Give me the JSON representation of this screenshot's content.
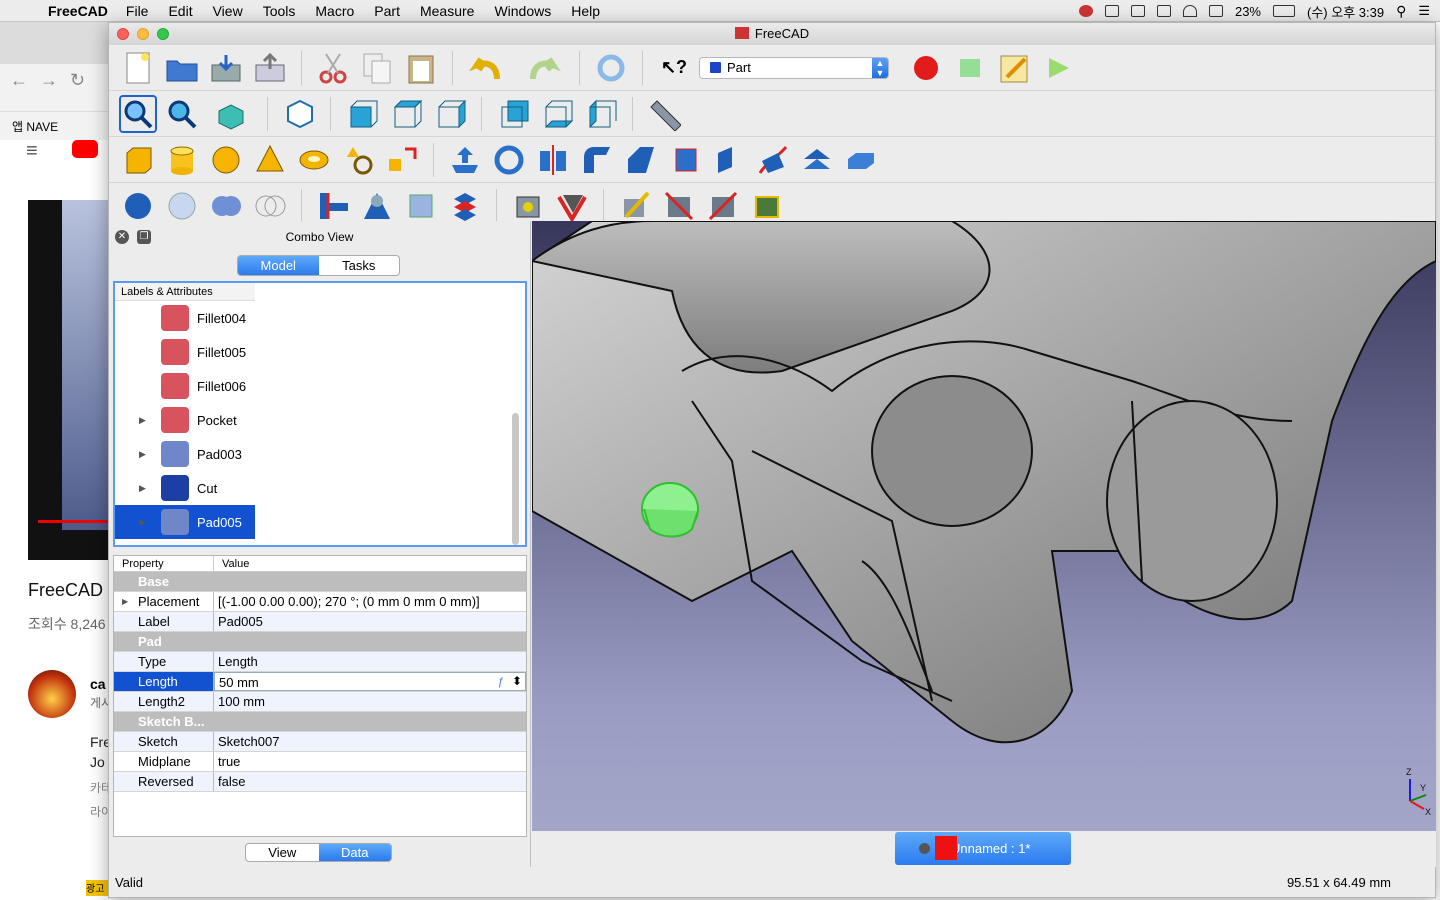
{
  "macos_menubar": {
    "app_name": "FreeCAD",
    "menus": [
      "File",
      "Edit",
      "View",
      "Tools",
      "Macro",
      "Part",
      "Measure",
      "Windows",
      "Help"
    ],
    "battery": "23%",
    "clock": "(수) 오후 3:39"
  },
  "browser_background": {
    "bookmark_apps": "앱",
    "bookmark_naver": "NAVE",
    "video_title": "FreeCAD U",
    "views": "조회수 8,246",
    "channel": "ca",
    "channel_sub": "게시",
    "desc_lines": [
      "Fre",
      "Jo",
      "카테",
      "라이"
    ],
    "ad_label": "광고"
  },
  "window": {
    "title": "FreeCAD",
    "workbench": "Part"
  },
  "combo_view": {
    "title": "Combo View",
    "tabs": [
      "Model",
      "Tasks"
    ],
    "active_tab": "Model",
    "tree_header": "Labels & Attributes",
    "tree_items": [
      {
        "label": "Fillet004",
        "expandable": false,
        "color": "#d9535e",
        "selected": false
      },
      {
        "label": "Fillet005",
        "expandable": false,
        "color": "#d9535e",
        "selected": false
      },
      {
        "label": "Fillet006",
        "expandable": false,
        "color": "#d9535e",
        "selected": false
      },
      {
        "label": "Pocket",
        "expandable": true,
        "color": "#d9535e",
        "selected": false
      },
      {
        "label": "Pad003",
        "expandable": true,
        "color": "#6f86c9",
        "selected": false
      },
      {
        "label": "Cut",
        "expandable": true,
        "color": "#1d3fa3",
        "selected": false
      },
      {
        "label": "Pad005",
        "expandable": true,
        "color": "#6f86c9",
        "selected": true
      }
    ],
    "property_header": {
      "property": "Property",
      "value": "Value"
    },
    "properties": [
      {
        "group": "Base"
      },
      {
        "name": "Placement",
        "value": "[(-1.00 0.00 0.00); 270 °; (0 mm  0 mm  0 mm)]",
        "expandable": true
      },
      {
        "name": "Label",
        "value": "Pad005"
      },
      {
        "group": "Pad"
      },
      {
        "name": "Type",
        "value": "Length"
      },
      {
        "name": "Length",
        "value": "50 mm",
        "highlight": true
      },
      {
        "name": "Length2",
        "value": "100 mm"
      },
      {
        "group": "Sketch B..."
      },
      {
        "name": "Sketch",
        "value": "Sketch007"
      },
      {
        "name": "Midplane",
        "value": "true"
      },
      {
        "name": "Reversed",
        "value": "false"
      }
    ],
    "bottom_tabs": [
      "View",
      "Data"
    ],
    "active_bottom_tab": "Data"
  },
  "document_tab": "Unnamed : 1*",
  "status": {
    "message": "Valid",
    "dimensions": "95.51 x 64.49 mm"
  },
  "axis_labels": {
    "z": "Z",
    "y": "Y",
    "x": "X"
  },
  "colors": {
    "accent": "#2a7bef",
    "selection": "#1252d1",
    "viewport_top": "#37365b",
    "viewport_bottom": "#a4a6c8"
  }
}
